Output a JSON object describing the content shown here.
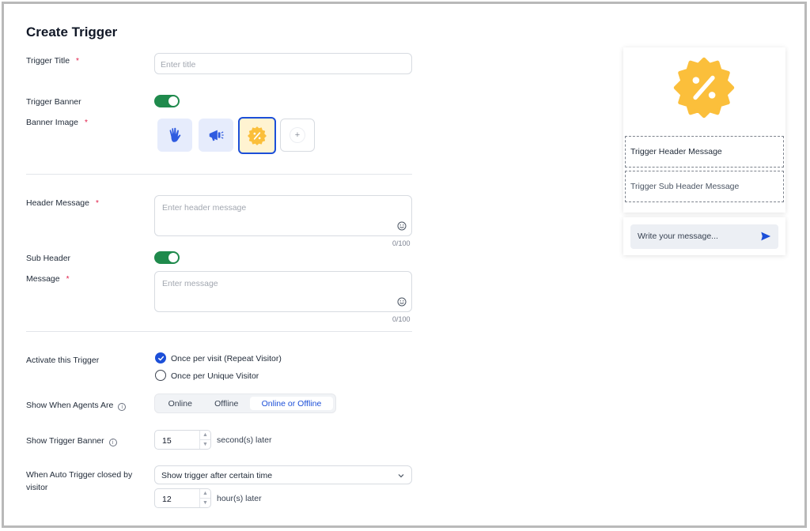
{
  "page": {
    "title": "Create Trigger"
  },
  "trigger_title": {
    "label": "Trigger Title",
    "required": "*",
    "placeholder": "Enter title"
  },
  "trigger_banner": {
    "label": "Trigger Banner",
    "enabled": true
  },
  "banner_image": {
    "label": "Banner Image",
    "required": "*",
    "options": [
      "wave-hand-icon",
      "megaphone-icon",
      "discount-badge-icon",
      "add-icon"
    ],
    "selected": "discount-badge-icon",
    "add_symbol": "+"
  },
  "header_message": {
    "label": "Header Message",
    "required": "*",
    "placeholder": "Enter header message",
    "counter": "0/100"
  },
  "sub_header": {
    "label": "Sub Header",
    "enabled": true
  },
  "message": {
    "label": "Message",
    "required": "*",
    "placeholder": "Enter message",
    "counter": "0/100"
  },
  "activate": {
    "label": "Activate this Trigger",
    "options": [
      "Once per visit (Repeat Visitor)",
      "Once per Unique Visitor"
    ],
    "selected": "Once per visit (Repeat Visitor)"
  },
  "agents": {
    "label": "Show When Agents Are",
    "options": [
      "Online",
      "Offline",
      "Online or Offline"
    ],
    "selected": "Online or Offline"
  },
  "show_banner": {
    "label": "Show Trigger Banner",
    "value": "15",
    "suffix": "second(s) later"
  },
  "auto_closed": {
    "label_line1": "When Auto Trigger closed by",
    "label_line2": "visitor",
    "select_value": "Show trigger after certain time",
    "value": "12",
    "suffix": "hour(s) later"
  },
  "preview": {
    "header": "Trigger Header Message",
    "sub_header": "Trigger Sub Header Message",
    "input_placeholder": "Write your message..."
  },
  "colors": {
    "accent": "#1c4fd8",
    "toggle_on": "#1f8a4c",
    "banner_yellow": "#fbbf3b",
    "required": "#e11d48"
  }
}
